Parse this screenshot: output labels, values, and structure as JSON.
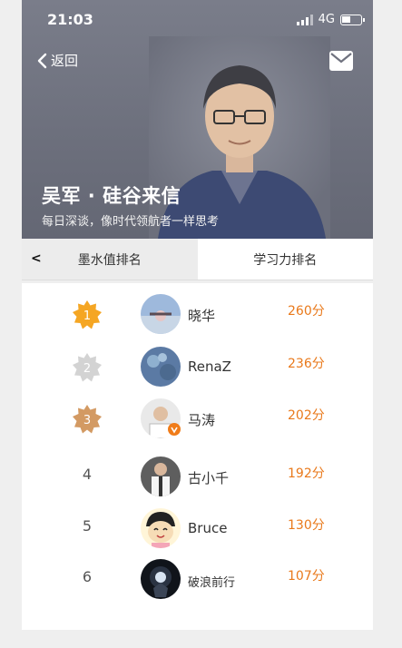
{
  "status": {
    "time": "21:03",
    "network": "4G"
  },
  "header": {
    "back_label": "返回",
    "title": "吴军 · 硅谷来信",
    "subtitle": "每日深谈，像时代领航者一样思考"
  },
  "tabs": [
    {
      "label": "墨水值排名",
      "prefix": "<"
    },
    {
      "label": "学习力排名"
    }
  ],
  "ranking": [
    {
      "rank": "1",
      "name": "晓华",
      "score": "260分"
    },
    {
      "rank": "2",
      "name": "RenaZ",
      "score": "236分"
    },
    {
      "rank": "3",
      "name": "马涛",
      "score": "202分"
    },
    {
      "rank": "4",
      "name": "古小千",
      "score": "192分"
    },
    {
      "rank": "5",
      "name": "Bruce",
      "score": "130分"
    },
    {
      "rank": "6",
      "name": "破浪前行",
      "score": "107分"
    }
  ],
  "colors": {
    "accent": "#e9791b",
    "gold": "#f5a623",
    "silver": "#d3d3d3",
    "bronze": "#d39a63"
  }
}
